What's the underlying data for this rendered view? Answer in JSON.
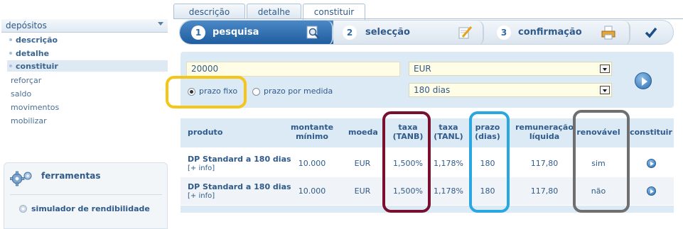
{
  "sidebar": {
    "section_title": "depósitos",
    "sub_items": [
      {
        "label": "descrição"
      },
      {
        "label": "detalhe"
      },
      {
        "label": "constituir"
      }
    ],
    "links": [
      {
        "label": "reforçar"
      },
      {
        "label": "saldo"
      },
      {
        "label": "movimentos"
      },
      {
        "label": "mobilizar"
      }
    ],
    "tools": {
      "title": "ferramentas",
      "link": "simulador de rendibilidade"
    }
  },
  "tabs": [
    {
      "label": "descrição"
    },
    {
      "label": "detalhe"
    },
    {
      "label": "constituir",
      "active": true
    }
  ],
  "wizard": {
    "steps": [
      {
        "num": "1",
        "label": "pesquisa",
        "icon": "magnifier-icon"
      },
      {
        "num": "2",
        "label": "selecção",
        "icon": "pen-paper-icon"
      },
      {
        "num": "3",
        "label": "confirmação",
        "icon": "printer-icon"
      }
    ],
    "final_icon": "checkmark-icon"
  },
  "form": {
    "amount": "20000",
    "currency": "EUR",
    "term": "180 dias",
    "radio_fixed": "prazo fixo",
    "radio_custom": "prazo por medida"
  },
  "table": {
    "headers": {
      "produto": "produto",
      "montante_1": "montante",
      "montante_2": "mínimo",
      "moeda": "moeda",
      "tanb_1": "taxa",
      "tanb_2": "(TANB)",
      "tanl_1": "taxa",
      "tanl_2": "(TANL)",
      "prazo_1": "prazo",
      "prazo_2": "(dias)",
      "remun_1": "remuneração",
      "remun_2": "líquida",
      "renovavel": "renovável",
      "constituir": "constituir"
    },
    "rows": [
      {
        "produto": "DP Standard a 180 dias",
        "info": "[+ info]",
        "montante": "10.000",
        "moeda": "EUR",
        "tanb": "1,500%",
        "tanl": "1,178%",
        "prazo": "180",
        "remun": "117,80",
        "renovavel": "sim"
      },
      {
        "produto": "DP Standard a 180 dias",
        "info": "[+ info]",
        "montante": "10.000",
        "moeda": "EUR",
        "tanb": "1,500%",
        "tanl": "1,178%",
        "prazo": "180",
        "remun": "117,80",
        "renovavel": "não"
      }
    ]
  },
  "colors": {
    "ring_yellow": "#f5c518",
    "ring_maroon": "#7a1030",
    "ring_blue": "#2aa7e0",
    "ring_gray": "#6f6f6f"
  }
}
